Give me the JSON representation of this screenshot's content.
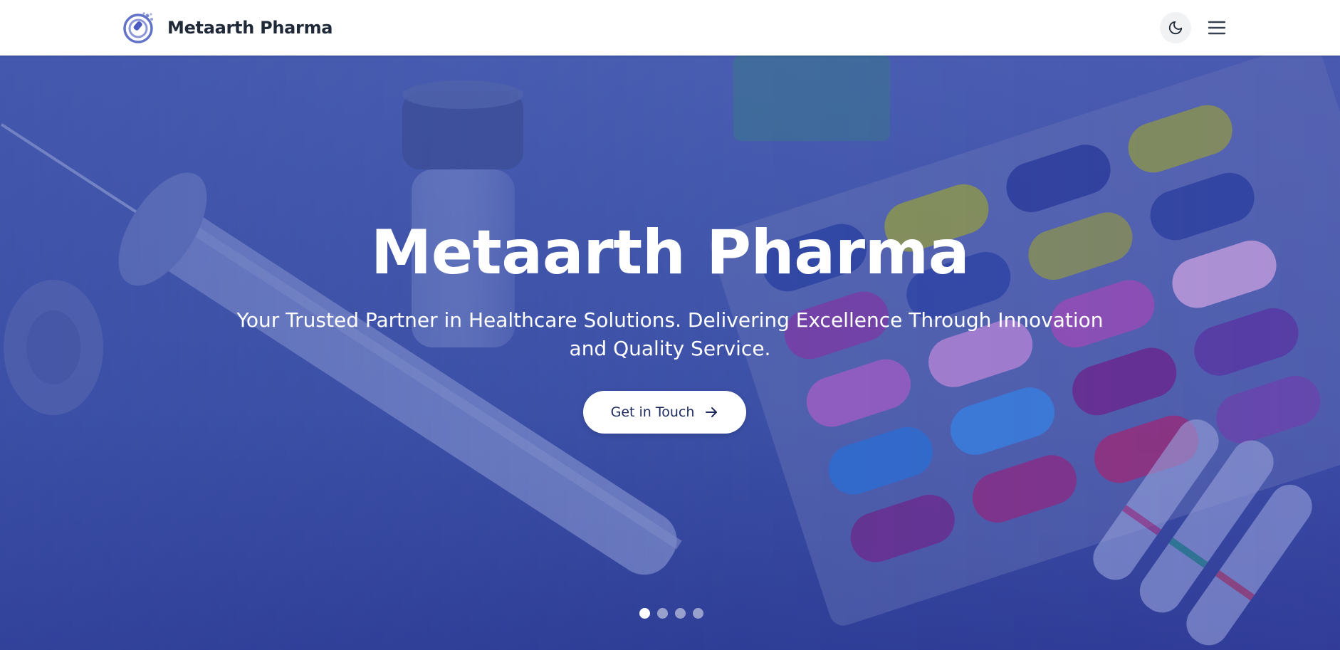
{
  "header": {
    "brand_name": "Metaarth Pharma",
    "logo_icon": "metaarth-logo",
    "theme_toggle_icon": "moon-icon",
    "menu_icon": "hamburger-menu-icon"
  },
  "hero": {
    "title": "Metaarth Pharma",
    "subtitle": "Your Trusted Partner in Healthcare Solutions. Delivering Excellence Through Innovation and Quality Service.",
    "cta_label": "Get in Touch",
    "cta_icon": "arrow-right-icon",
    "slides_total": 4,
    "active_slide": 1
  },
  "colors": {
    "brand_text": "#1f2937",
    "hero_overlay": "#3b4fa6",
    "cta_text": "#1e2a5e",
    "logo_accent": "#6272c8"
  }
}
